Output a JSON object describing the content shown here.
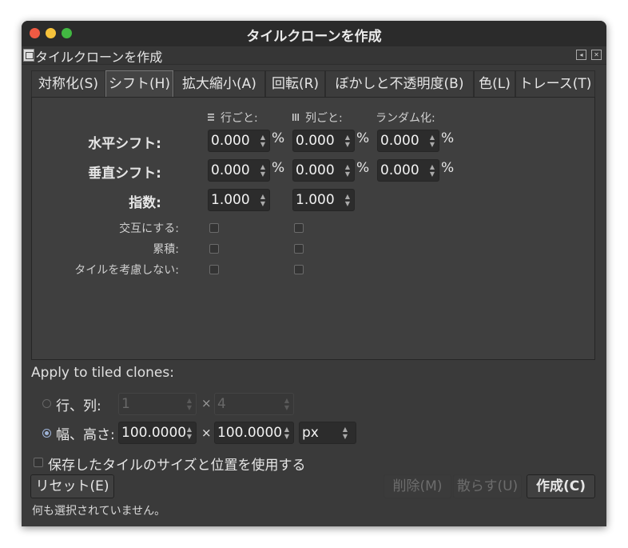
{
  "window": {
    "title": "タイルクローンを作成"
  },
  "panel": {
    "title": "タイルクローンを作成"
  },
  "tabs": [
    {
      "label": "対称化(S)"
    },
    {
      "label": "シフト(H)"
    },
    {
      "label": "拡大縮小(A)"
    },
    {
      "label": "回転(R)"
    },
    {
      "label": "ぼかしと不透明度(B)"
    },
    {
      "label": "色(L)"
    },
    {
      "label": "トレース(T)"
    }
  ],
  "shift": {
    "headers": {
      "per_row": "行ごと:",
      "per_column": "列ごと:",
      "random": "ランダム化:"
    },
    "horizontal": {
      "label": "水平シフト:",
      "per_row": "0.000",
      "per_column": "0.000",
      "random": "0.000",
      "unit": "%"
    },
    "vertical": {
      "label": "垂直シフト:",
      "per_row": "0.000",
      "per_column": "0.000",
      "random": "0.000",
      "unit": "%"
    },
    "exponent": {
      "label": "指数:",
      "per_row": "1.000",
      "per_column": "1.000"
    },
    "alternate": {
      "label": "交互にする:"
    },
    "cumulate": {
      "label": "累積:"
    },
    "exclude_tile": {
      "label": "タイルを考慮しない:"
    }
  },
  "apply": {
    "heading": "Apply to tiled clones:",
    "rows_cols": {
      "label": "行、列:",
      "rows": "1",
      "cols": "4",
      "times": "×"
    },
    "width_height": {
      "label": "幅、高さ:",
      "width": "100.0000",
      "height": "100.0000",
      "times": "×",
      "unit": "px"
    },
    "use_saved": {
      "label": "保存したタイルのサイズと位置を使用する"
    }
  },
  "buttons": {
    "reset": "リセット(E)",
    "remove": "削除(M)",
    "unclump": "散らす(U)",
    "create": "作成(C)"
  },
  "status": "何も選択されていません。"
}
